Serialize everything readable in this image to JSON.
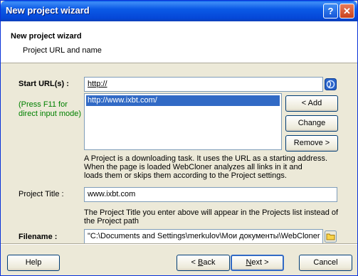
{
  "window": {
    "title": "New project wizard",
    "help_glyph": "?",
    "close_glyph": "✕"
  },
  "header": {
    "title": "New project wizard",
    "subtitle": "Project URL and name"
  },
  "start_url": {
    "label": "Start URL(s) :",
    "hint": [
      "(Press F11 for",
      "direct input mode)"
    ],
    "input_value": "http://",
    "list_items": [
      "http://www.ixbt.com/"
    ],
    "add_label": "< Add",
    "change_label": "Change",
    "remove_label": "Remove >",
    "description": [
      "A Project is a downloading task. It uses the URL as a starting address.",
      "When the page is loaded WebCloner analyzes all links in it and",
      "loads them or skips them according to the Project settings."
    ]
  },
  "project_title": {
    "label": "Project Title :",
    "value": "www.ixbt.com",
    "description": [
      "The Project Title you enter above will appear in the Projects list instead of",
      "the Project path"
    ]
  },
  "filename": {
    "label": "Filename :",
    "value": "\"C:\\Documents and Settings\\merkulov\\Мои документы\\WebCloner"
  },
  "footer": {
    "help_label": "Help",
    "back_prefix": "< ",
    "back_accel": "B",
    "back_rest": "ack",
    "next_accel": "N",
    "next_rest": "ext >",
    "cancel_label": "Cancel"
  },
  "colors": {
    "hint_green": "#008000",
    "selection": "#316ac5",
    "titlebar": "#0b5ae6"
  },
  "icons": {
    "url_button": "webcloner-globe-icon",
    "browse_button": "folder-icon"
  }
}
